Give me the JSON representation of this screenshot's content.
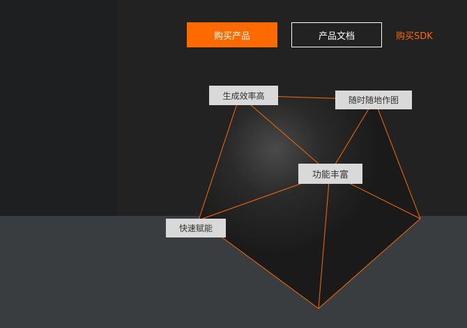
{
  "header": {
    "buy_product_label": "购买产品",
    "docs_label": "产品文档",
    "buy_sdk_label": "购买SDK"
  },
  "features": {
    "efficiency": "生成效率高",
    "anytime": "随时随地作图",
    "rich": "功能丰富",
    "fast": "快速赋能"
  },
  "colors": {
    "accent": "#ff6a00",
    "background": "#222223",
    "band": "#3a3d40",
    "label_bg": "#d9d9d9"
  }
}
